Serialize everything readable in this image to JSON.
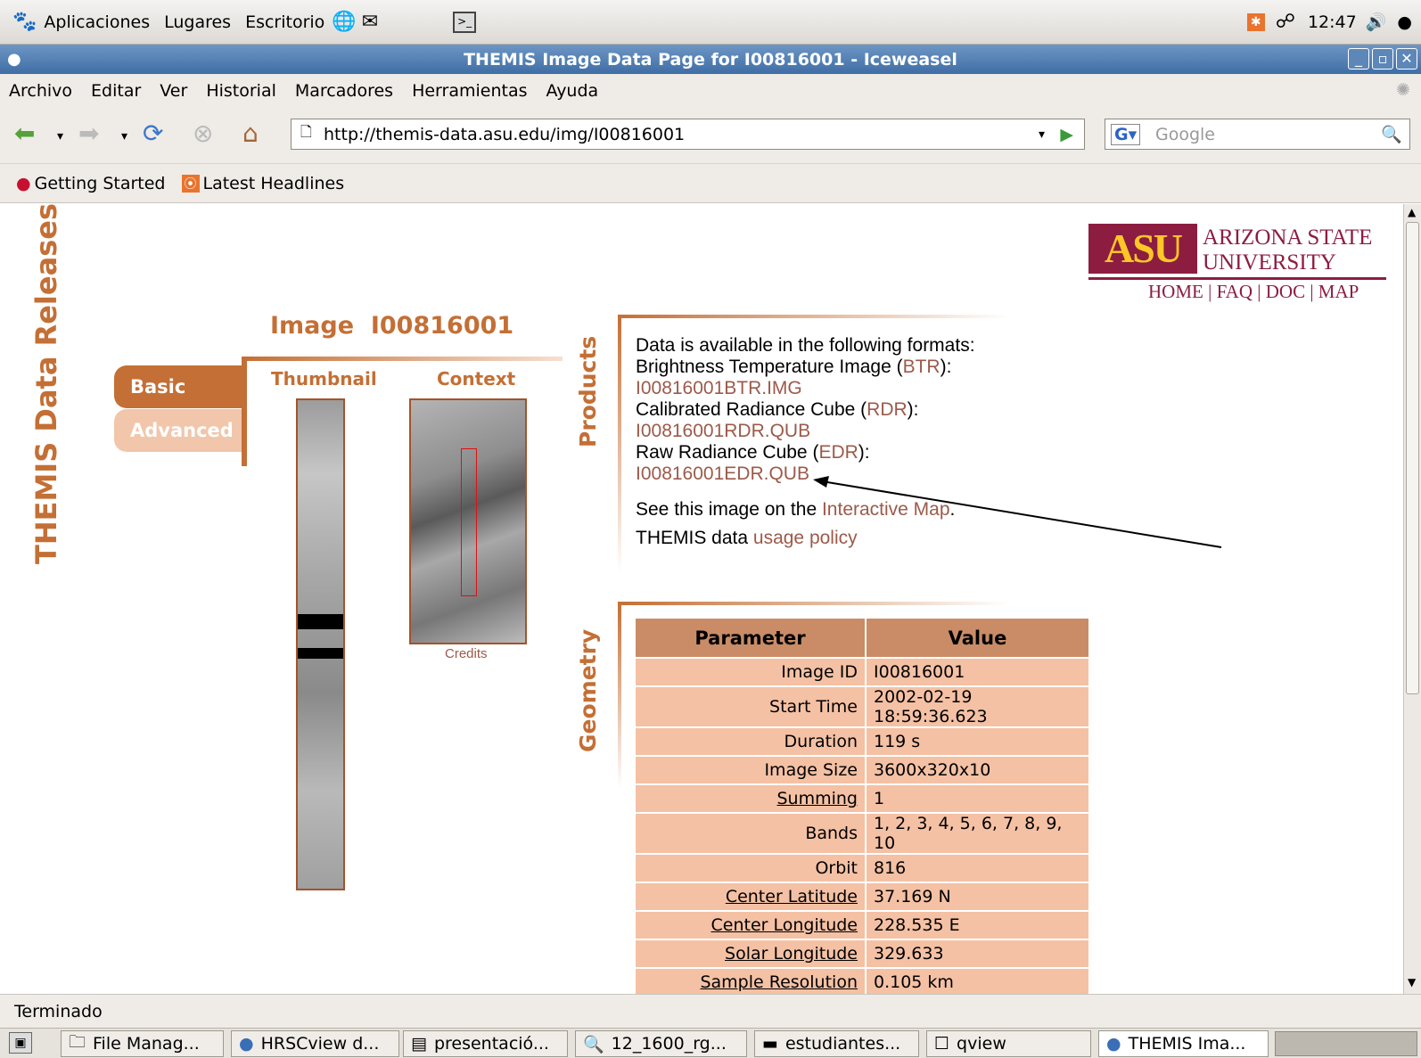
{
  "desktop": {
    "menus": [
      "Aplicaciones",
      "Lugares",
      "Escritorio"
    ],
    "clock": "12:47"
  },
  "window": {
    "title": "THEMIS Image Data Page for I00816001 - Iceweasel"
  },
  "menubar": [
    "Archivo",
    "Editar",
    "Ver",
    "Historial",
    "Marcadores",
    "Herramientas",
    "Ayuda"
  ],
  "nav": {
    "url": "http://themis-data.asu.edu/img/I00816001",
    "search_placeholder": "Google"
  },
  "bookmarks": [
    "Getting Started",
    "Latest Headlines"
  ],
  "page": {
    "side_title": "THEMIS Data Releases",
    "logo": {
      "line1": "ARIZONA STATE",
      "line2": "UNIVERSITY",
      "links": [
        "HOME",
        "FAQ",
        "DOC",
        "MAP"
      ]
    },
    "image_title": "Image  I00816001",
    "tabs": [
      "Basic",
      "Advanced"
    ],
    "thumb_label": "Thumbnail",
    "context_label": "Context",
    "credits": "Credits",
    "products_label": "Products",
    "geometry_label": "Geometry",
    "products": {
      "intro": "Data is available in the following formats:",
      "btr_label": "Brightness Temperature Image (",
      "btr_code": "BTR",
      "btr_file": "I00816001BTR.IMG",
      "rdr_label": "Calibrated Radiance Cube (",
      "rdr_code": "RDR",
      "rdr_file": "I00816001RDR.QUB",
      "edr_label": "Raw Radiance Cube (",
      "edr_code": "EDR",
      "edr_file": "I00816001EDR.QUB",
      "map_text": "See this image on the ",
      "map_link": "Interactive Map",
      "policy_text": "THEMIS data ",
      "policy_link": "usage policy"
    },
    "table": {
      "headers": [
        "Parameter",
        "Value"
      ],
      "rows": [
        [
          "Image ID",
          "I00816001"
        ],
        [
          "Start Time",
          "2002-02-19 18:59:36.623"
        ],
        [
          "Duration",
          "119 s"
        ],
        [
          "Image Size",
          "3600x320x10"
        ],
        [
          "Summing",
          "1"
        ],
        [
          "Bands",
          "1, 2, 3, 4, 5, 6, 7, 8, 9, 10"
        ],
        [
          "Orbit",
          "816"
        ],
        [
          "Center Latitude",
          "37.169 N"
        ],
        [
          "Center Longitude",
          "228.535 E"
        ],
        [
          "Solar Longitude",
          "329.633"
        ],
        [
          "Sample Resolution",
          "0.105 km"
        ]
      ]
    }
  },
  "status": "Terminado",
  "taskbar": [
    "File Manag...",
    "HRSCview d...",
    "presentació...",
    "12_1600_rg...",
    "estudiantes...",
    "qview",
    "THEMIS Ima..."
  ]
}
